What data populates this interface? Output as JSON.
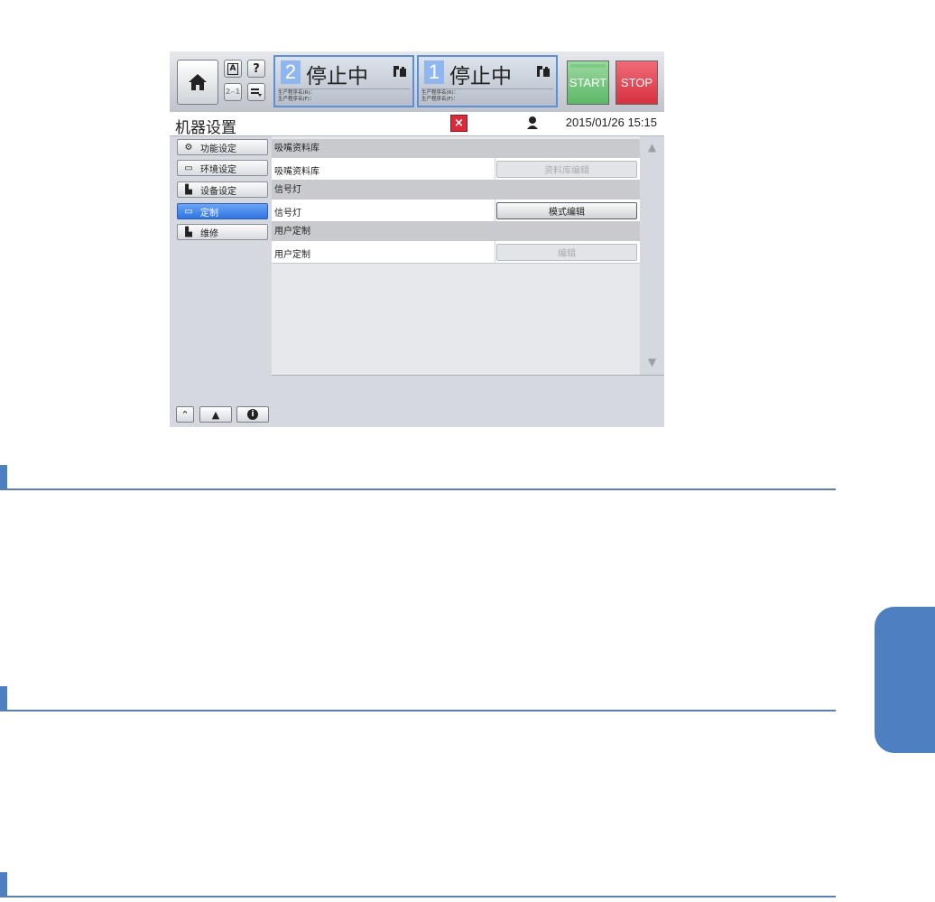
{
  "topbar": {
    "lang_label": "A",
    "help_label": "?",
    "users_label": "2⌢1",
    "lanes": [
      {
        "number": "2",
        "status": "停止中",
        "info_r": "生产程序名(R)：",
        "info_f": "生产程序名(F)："
      },
      {
        "number": "1",
        "status": "停止中",
        "info_r": "生产程序名(R)：",
        "info_f": "生产程序名(F)："
      }
    ],
    "start_label": "START",
    "stop_label": "STOP"
  },
  "title_bar": {
    "title": "机器设置",
    "close_label": "×",
    "datetime": "2015/01/26 15:15"
  },
  "sidebar": {
    "items": [
      {
        "label": "功能设定",
        "icon": "function-icon"
      },
      {
        "label": "环境设定",
        "icon": "environment-icon"
      },
      {
        "label": "设备设定",
        "icon": "device-icon"
      },
      {
        "label": "定制",
        "icon": "custom-icon",
        "active": true
      },
      {
        "label": "维修",
        "icon": "maintenance-icon"
      }
    ]
  },
  "sections": [
    {
      "header": "吸嘴资料库",
      "row_label": "吸嘴资料库",
      "button": "资料库编辑",
      "enabled": false
    },
    {
      "header": "信号灯",
      "row_label": "信号灯",
      "button": "模式编辑",
      "enabled": true
    },
    {
      "header": "用户定制",
      "row_label": "用户定制",
      "button": "编辑",
      "enabled": false
    }
  ],
  "colors": {
    "accent_blue": "#4e7fc0",
    "start_green": "#5cb866",
    "stop_red": "#d7313f",
    "active_item": "#2f73e0"
  }
}
